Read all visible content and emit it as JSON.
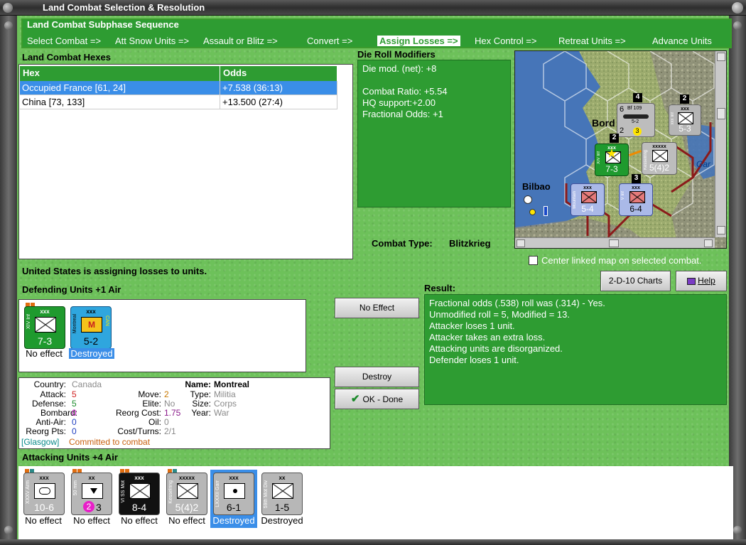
{
  "window": {
    "title": "Land Combat Selection & Resolution"
  },
  "subphase": {
    "title": "Land Combat Subphase Sequence",
    "items": [
      "Select Combat =>",
      "Att Snow Units =>",
      "Assault or Blitz =>",
      "Convert =>",
      "Assign Losses =>",
      "Hex Control =>",
      "Retreat Units =>",
      "Advance Units"
    ],
    "active_index": 4
  },
  "hexes": {
    "title": "Land Combat Hexes",
    "columns": [
      "Hex",
      "Odds"
    ],
    "rows": [
      {
        "hex": "Occupied France [61, 24]",
        "odds": "+7.538 (36:13)",
        "selected": true
      },
      {
        "hex": "China [73, 133]",
        "odds": "+13.500 (27:4)",
        "selected": false
      }
    ]
  },
  "die": {
    "title": "Die Roll Modifiers",
    "net": "Die mod. (net): +8",
    "ratio": "Combat Ratio: +5.54",
    "hq": "HQ support:+2.00",
    "frac": "Fractional Odds: +1"
  },
  "combat_type": {
    "label": "Combat Type:",
    "value": "Blitzkrieg"
  },
  "map": {
    "labels": {
      "bord": "Bord",
      "bilbao": "Bilbao",
      "gar": "Gar"
    },
    "units": [
      {
        "top": "xxx",
        "side": "xxx Inf",
        "value": "5-3"
      },
      {
        "top": "xxx",
        "side": "XIV Inf",
        "value": "7-3"
      },
      {
        "top": "xxxxx",
        "side": "Kesselring",
        "value": "5(4)2"
      },
      {
        "top": "xxx",
        "side": "Mountain",
        "value": "5-4"
      },
      {
        "top": "xxx",
        "side": "V Inf",
        "value": "6-4"
      }
    ],
    "air": {
      "name": "Bf 109",
      "value": "5-2",
      "top": "6",
      "bottom": "2",
      "badge": "3"
    },
    "stacks": [
      "4",
      "2",
      "2",
      "3"
    ]
  },
  "center_checkbox": {
    "label": "Center linked map on selected combat.",
    "checked": false
  },
  "status": "United States is assigning losses to units.",
  "buttons": {
    "charts": "2-D-10 Charts",
    "help": "Help",
    "no_effect": "No Effect",
    "destroy": "Destroy",
    "ok": "OK - Done"
  },
  "defending": {
    "title": "Defending Units +1 Air",
    "units": [
      {
        "top": "xxx",
        "side": "XIV Inf",
        "value": "7-3",
        "status": "No effect",
        "color": "#1f9a2e",
        "selected": false
      },
      {
        "top": "xxx",
        "side": "Montreal",
        "side2": "CAN",
        "mark": "M",
        "value": "5-2",
        "status": "Destroyed",
        "color": "#2fa6de",
        "selected": true
      }
    ]
  },
  "result": {
    "title": "Result:",
    "lines": [
      "Fractional odds (.538) roll was (.314)  - Yes.",
      "Unmodified roll = 5, Modified = 13.",
      "Attacker loses 1 unit.",
      "Attacker takes an extra loss.",
      "Attacking units are disorganized.",
      "Defender loses 1 unit."
    ]
  },
  "info": {
    "country_label": "Country:",
    "country": "Canada",
    "attack_label": "Attack:",
    "attack": "5",
    "defense_label": "Defense:",
    "defense": "5",
    "bombard_label": "Bombard:",
    "bombard": "0",
    "antiair_label": "Anti-Air:",
    "antiair": "0",
    "reorgpts_label": "Reorg Pts:",
    "reorgpts": "0",
    "move_label": "Move:",
    "move": "2",
    "elite_label": "Elite:",
    "elite": "No",
    "reorgcost_label": "Reorg Cost:",
    "reorgcost": "1.75",
    "oil_label": "Oil:",
    "oil": "0",
    "costturns_label": "Cost/Turns:",
    "costturns": "2/1",
    "name_label": "Name:",
    "name": "Montreal",
    "type_label": "Type:",
    "type": "Militia",
    "size_label": "Size:",
    "size": "Corps",
    "year_label": "Year:",
    "year": "War",
    "location": "[Glasgow]",
    "committed": "Committed to combat"
  },
  "attacking": {
    "title": "Attacking Units +4 Air",
    "units": [
      {
        "top": "xxx",
        "side": "XXXV Arm",
        "value": "10-6",
        "status": "No effect",
        "color": "#b7b7b7",
        "selected": false
      },
      {
        "top": "xx",
        "side": "50 mm",
        "value": "3",
        "badge": "2",
        "status": "No effect",
        "color": "#b7b7b7",
        "selected": false
      },
      {
        "top": "xxx",
        "side": "VI SS Mot",
        "value": "8-4",
        "status": "No effect",
        "color": "#111111",
        "selected": false
      },
      {
        "top": "xxxxx",
        "side": "Kesselring",
        "value": "5(4)2",
        "status": "No effect",
        "color": "#b7b7b7",
        "selected": false
      },
      {
        "top": "xxx",
        "side": "LXXXII Garr",
        "value": "6-1",
        "status": "Destroyed",
        "color": "#b7b7b7",
        "selected": true
      },
      {
        "top": "xx",
        "side": "59th Mot Div",
        "value": "1-5",
        "status": "Destroyed",
        "color": "#b7b7b7",
        "selected": false
      }
    ]
  }
}
